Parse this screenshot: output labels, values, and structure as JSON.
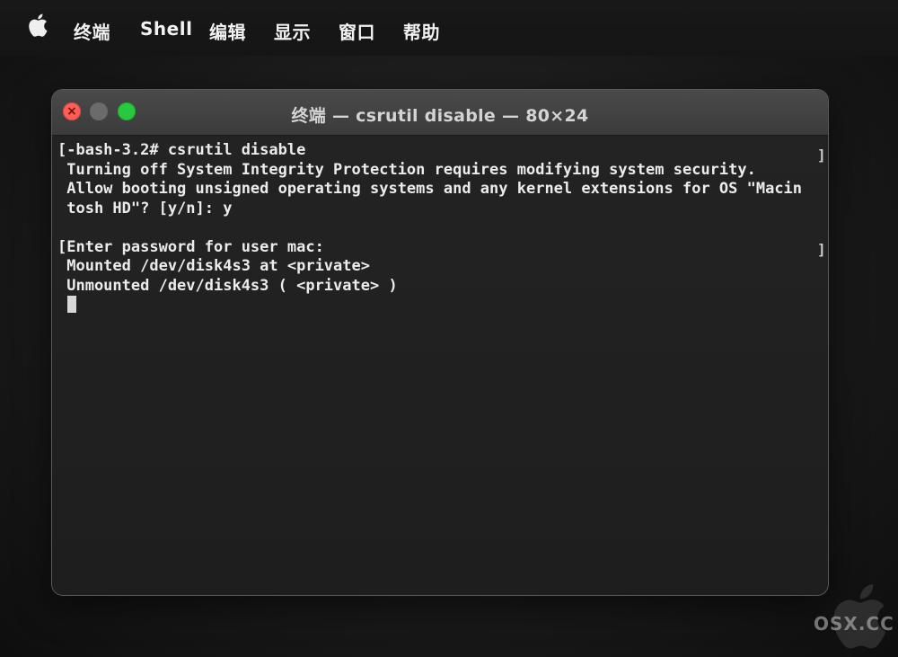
{
  "menubar": {
    "items": [
      "终端",
      "Shell",
      "编辑",
      "显示",
      "窗口",
      "帮助"
    ]
  },
  "window": {
    "title": "终端 — csrutil disable — 80×24",
    "close_glyph": "×"
  },
  "terminal": {
    "lines": [
      "[-bash-3.2# csrutil disable",
      " Turning off System Integrity Protection requires modifying system security.",
      " Allow booting unsigned operating systems and any kernel extensions for OS \"Macin",
      " tosh HD\"? [y/n]: y",
      "",
      "[Enter password for user mac:",
      " Mounted /dev/disk4s3 at <private>",
      " Unmounted /dev/disk4s3 ( <private> )"
    ],
    "right_bracket": "]"
  },
  "watermark": {
    "text": "OSX.CC"
  },
  "icons": {
    "apple": "apple-logo-icon",
    "watermark": "apple-logo-watermark-icon"
  },
  "colors": {
    "close": "#ff5f57",
    "minimize_inactive": "#6b6b6b",
    "zoom": "#28c840",
    "terminal_bg": "#1f1f1f",
    "text": "#ececec"
  }
}
